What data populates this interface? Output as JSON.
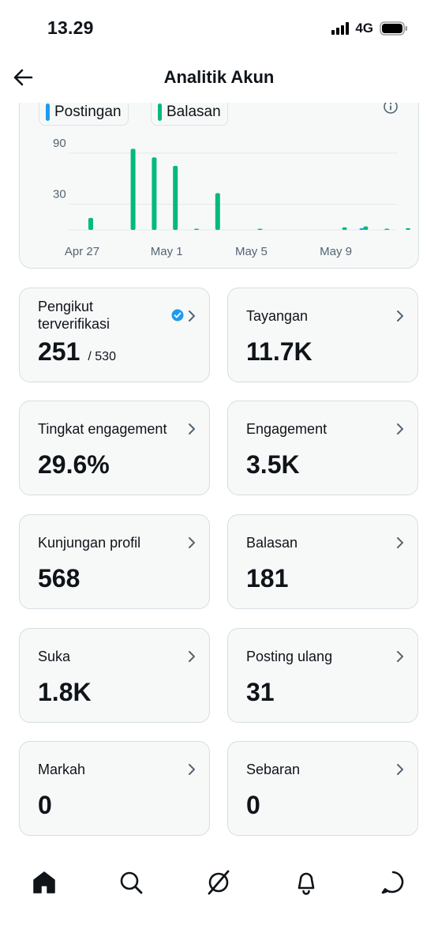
{
  "status": {
    "time": "13.29",
    "network": "4G"
  },
  "header": {
    "title": "Analitik Akun"
  },
  "chart_legend": {
    "series_a": "Postingan",
    "series_b": "Balasan"
  },
  "chart_data": {
    "type": "bar",
    "x_ticks": [
      "Apr 27",
      "May 1",
      "May 5",
      "May 9"
    ],
    "y_ticks": [
      90,
      30
    ],
    "ylim": [
      0,
      100
    ],
    "grid": true,
    "series": [
      {
        "name": "Postingan",
        "color": "#1d9bf0",
        "points": [
          {
            "x": "May 10",
            "y": 2
          }
        ]
      },
      {
        "name": "Balasan",
        "color": "#00ba7c",
        "points": [
          {
            "x": "Apr 27",
            "y": 14
          },
          {
            "x": "Apr 29",
            "y": 95
          },
          {
            "x": "Apr 30",
            "y": 85
          },
          {
            "x": "May 1",
            "y": 75
          },
          {
            "x": "May 2",
            "y": 1
          },
          {
            "x": "May 3",
            "y": 43
          },
          {
            "x": "May 5",
            "y": 1
          },
          {
            "x": "May 9",
            "y": 3
          },
          {
            "x": "May 10",
            "y": 4
          },
          {
            "x": "May 11",
            "y": 1
          },
          {
            "x": "May 12",
            "y": 2
          }
        ]
      }
    ]
  },
  "stats": [
    {
      "label": "Pengikut terverifikasi",
      "value": "251",
      "sub": "/ 530"
    },
    {
      "label": "Tayangan",
      "value": "11.7K"
    },
    {
      "label": "Tingkat engagement",
      "value": "29.6%"
    },
    {
      "label": "Engagement",
      "value": "3.5K"
    },
    {
      "label": "Kunjungan profil",
      "value": "568"
    },
    {
      "label": "Balasan",
      "value": "181"
    },
    {
      "label": "Suka",
      "value": "1.8K"
    },
    {
      "label": "Posting ulang",
      "value": "31"
    },
    {
      "label": "Markah",
      "value": "0"
    },
    {
      "label": "Sebaran",
      "value": "0"
    }
  ],
  "icons": {
    "back": "arrow-left-icon",
    "info": "info-icon",
    "chevron": "chevron-right-icon",
    "verified": "verified-badge-icon",
    "nav": [
      "home-icon",
      "search-icon",
      "grok-icon",
      "bell-icon",
      "messages-icon"
    ]
  },
  "colors": {
    "accent": "#1d9bf0",
    "reply": "#00ba7c",
    "card_bg": "#f7f9f9",
    "border": "#d6dde2"
  }
}
